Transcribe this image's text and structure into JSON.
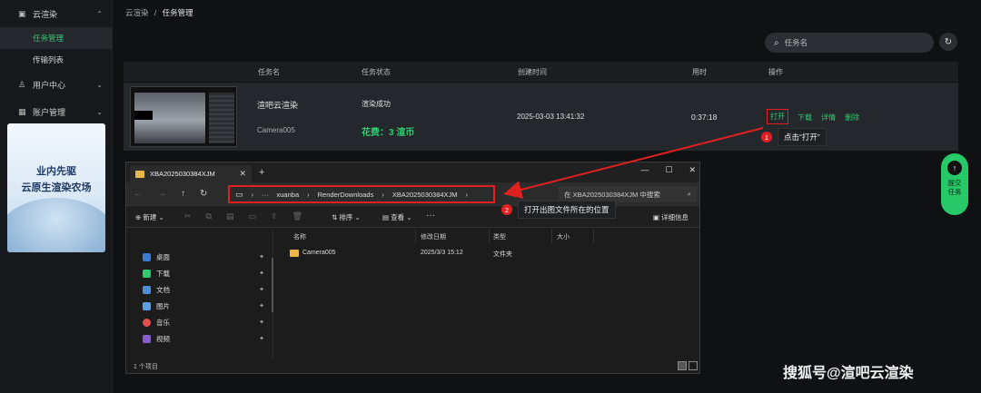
{
  "sidebar": {
    "groups": [
      {
        "icon": "image-icon",
        "label": "云渲染",
        "chevron": "^"
      },
      {
        "icon": "user-icon",
        "label": "用户中心",
        "chevron": "v"
      },
      {
        "icon": "grid-icon",
        "label": "账户管理",
        "chevron": "v"
      }
    ],
    "subitems": [
      {
        "label": "任务管理",
        "active": true
      },
      {
        "label": "传输列表",
        "active": false
      }
    ],
    "promo": {
      "line1": "业内先驱",
      "line2": "云原生渲染农场"
    }
  },
  "breadcrumb": {
    "parent": "云渲染",
    "sep": "/",
    "current": "任务管理"
  },
  "search": {
    "placeholder": "任务名"
  },
  "table": {
    "headers": [
      "任务名",
      "任务状态",
      "创建时间",
      "用时",
      "操作"
    ],
    "row": {
      "name": "渲吧云渲染",
      "camera": "Camera005",
      "status": "渲染成功",
      "fee": "花费：3 渲币",
      "created": "2025-03-03 13:41:32",
      "duration": "0:37:18",
      "actions": [
        "打开",
        "下载",
        "详情",
        "删除"
      ]
    }
  },
  "callouts": {
    "c1": {
      "num": "1",
      "text": "点击“打开”"
    },
    "c2": {
      "num": "2",
      "text": "打开出图文件所在的位置"
    }
  },
  "submit": {
    "line1": "提交",
    "line2": "任务",
    "icon": "arrow-up-icon"
  },
  "explorer": {
    "tab_title": "XBA2025030384XJM",
    "address": [
      "xuanba",
      "RenderDownloads",
      "XBA2025030384XJM"
    ],
    "search_placeholder": "在 XBA2025030384XJM 中搜索",
    "toolbar": {
      "new": "新建",
      "sort": "排序",
      "view": "查看",
      "details": "详细信息"
    },
    "quick_access": [
      {
        "label": "桌面",
        "color": "#3a7bd5"
      },
      {
        "label": "下载",
        "color": "#2ecc71"
      },
      {
        "label": "文档",
        "color": "#4a8fe0"
      },
      {
        "label": "图片",
        "color": "#5aa0e8"
      },
      {
        "label": "音乐",
        "color": "#e05050"
      },
      {
        "label": "视频",
        "color": "#8a5ad0"
      }
    ],
    "columns": [
      "名称",
      "修改日期",
      "类型",
      "大小"
    ],
    "files": [
      {
        "name": "Camera005",
        "date": "2025/3/3 15:12",
        "type": "文件夹",
        "size": ""
      }
    ],
    "status": "1 个项目"
  },
  "watermark": "搜狐号@渲吧云渲染"
}
